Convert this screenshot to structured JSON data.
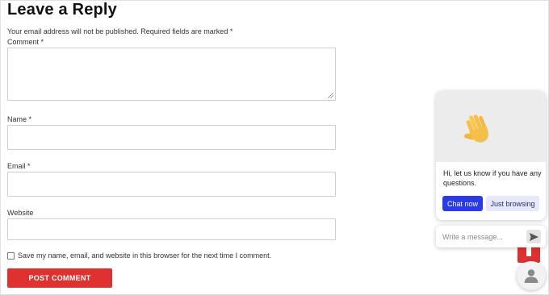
{
  "form": {
    "title": "Leave a Reply",
    "notes": "Your email address will not be published. Required fields are marked *",
    "comment_label": "Comment *",
    "name_label": "Name *",
    "email_label": "Email *",
    "website_label": "Website",
    "save_label": "Save my name, email, and website in this browser for the next time I comment.",
    "submit_label": "POST COMMENT"
  },
  "chat": {
    "message": "Hi, let us know if you have any questions.",
    "chat_now_label": "Chat now",
    "browsing_label": "Just browsing",
    "input_placeholder": "Write a message..."
  },
  "colors": {
    "accent_red": "#e03131",
    "chat_blue": "#2a3be6"
  },
  "icons": {
    "wave": "waving-hand-icon",
    "send": "send-icon",
    "avatar": "user-avatar-icon",
    "scroll_top": "arrow-up-icon"
  }
}
